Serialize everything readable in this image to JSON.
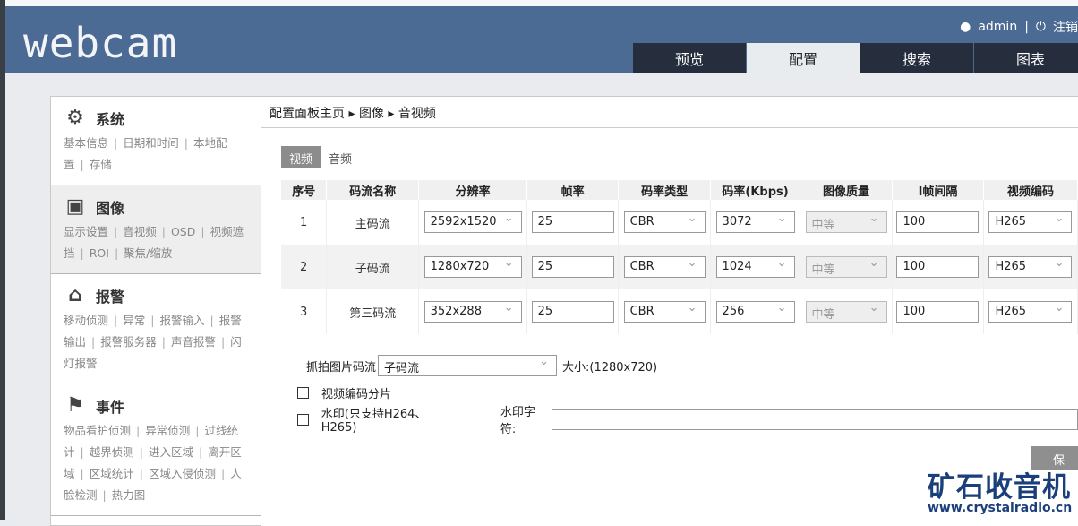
{
  "header": {
    "logo": "webcam",
    "user": "admin",
    "logout": "注销",
    "tabs": [
      "预览",
      "配置",
      "搜索",
      "图表"
    ],
    "active_tab": 1
  },
  "sidebar": [
    {
      "title": "系统",
      "icon": "gear-icon",
      "links": [
        "基本信息",
        "日期和时间",
        "本地配置",
        "存储"
      ]
    },
    {
      "title": "图像",
      "icon": "monitor-icon",
      "links": [
        "显示设置",
        "音视频",
        "OSD",
        "视频遮挡",
        "ROI",
        "聚焦/缩放"
      ]
    },
    {
      "title": "报警",
      "icon": "alarm-icon",
      "links": [
        "移动侦测",
        "异常",
        "报警输入",
        "报警输出",
        "报警服务器",
        "声音报警",
        "闪灯报警"
      ]
    },
    {
      "title": "事件",
      "icon": "flag-icon",
      "links": [
        "物品看护侦测",
        "异常侦测",
        "过线统计",
        "越界侦测",
        "进入区域",
        "离开区域",
        "区域统计",
        "区域入侵侦测",
        "人脸检测",
        "热力图"
      ]
    }
  ],
  "breadcrumb": [
    "配置面板主页",
    "图像",
    "音视频"
  ],
  "subtabs": [
    "视频",
    "音频"
  ],
  "table": {
    "headers": [
      "序号",
      "码流名称",
      "分辨率",
      "帧率",
      "码率类型",
      "码率(Kbps)",
      "图像质量",
      "I帧间隔",
      "视频编码"
    ],
    "rows": [
      [
        "1",
        "主码流",
        "2592x1520",
        "25",
        "CBR",
        "3072",
        "中等",
        "100",
        "H265"
      ],
      [
        "2",
        "子码流",
        "1280x720",
        "25",
        "CBR",
        "1024",
        "中等",
        "100",
        "H265"
      ],
      [
        "3",
        "第三码流",
        "352x288",
        "25",
        "CBR",
        "256",
        "中等",
        "100",
        "H265"
      ]
    ]
  },
  "snapshot": {
    "label": "抓拍图片码流",
    "value": "子码流",
    "size": "大小:(1280x720)"
  },
  "options": {
    "slice": "视频编码分片",
    "watermark": "水印(只支持H264、H265)",
    "watermark_text_label": "水印字符:",
    "watermark_text": ""
  },
  "save": "保存",
  "watermark_logo": {
    "title": "矿石收音机",
    "url": "www.crystalradio.cn"
  }
}
